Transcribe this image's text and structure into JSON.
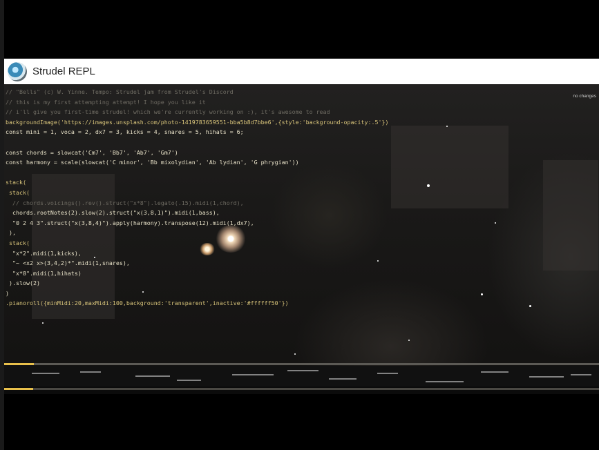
{
  "header": {
    "title": "Strudel REPL",
    "logo_icon": "strudel-logo-icon"
  },
  "editor": {
    "status": "no changes",
    "lines": [
      {
        "text": "// \"Bells\" (c) W. Yinne. Tempo: Strudel jam from Strudel's Discord",
        "cls": "c-comment"
      },
      {
        "text": "// this is my first attempting attempt! I hope you like it",
        "cls": "c-comment"
      },
      {
        "text": "// i'll give you first-time strudel! which we're currently working on :), it's awesome to read",
        "cls": "c-comment"
      },
      {
        "text": "backgroundImage('https://images.unsplash.com/photo-1419783659551-bba5b8d7bbe6',{style:'background-opacity:.5'})",
        "cls": "c-kw"
      },
      {
        "text": "const mini = 1, voca = 2, dx7 = 3, kicks = 4, snares = 5, hihats = 6;",
        "cls": ""
      },
      {
        "text": "",
        "cls": ""
      },
      {
        "text": "const chords = slowcat('Cm7', 'Bb7', 'Ab7', 'Gm7')",
        "cls": ""
      },
      {
        "text": "const harmony = scale(slowcat('C minor', 'Bb mixolydian', 'Ab lydian', 'G phrygian'))",
        "cls": ""
      },
      {
        "text": "",
        "cls": ""
      },
      {
        "text": "stack(",
        "cls": "c-kw"
      },
      {
        "text": " stack(",
        "cls": "c-kw"
      },
      {
        "text": "  // chords.voicings().rev().struct(\"x*8\").legato(.15).midi(1,chord),",
        "cls": "c-comment"
      },
      {
        "text": "  chords.rootNotes(2).slow(2).struct(\"x(3,8,1)\").midi(1,bass),",
        "cls": ""
      },
      {
        "text": "  \"0 2 4 3\".struct(\"x(3,8,4)\").apply(harmony).transpose(12).midi(1,dx7),",
        "cls": ""
      },
      {
        "text": " ),",
        "cls": ""
      },
      {
        "text": " stack(",
        "cls": "c-kw"
      },
      {
        "text": "  \"x*2\".midi(1,kicks),",
        "cls": ""
      },
      {
        "text": "  \"~ <x2 x>(3,4,2)*\".midi(1,snares),",
        "cls": ""
      },
      {
        "text": "  \"x*8\".midi(1,hihats)",
        "cls": ""
      },
      {
        "text": " ).slow(2)",
        "cls": ""
      },
      {
        "text": ")",
        "cls": ""
      },
      {
        "text": ".pianoroll({minMidi:20,maxMidi:100,background:'transparent',inactive:'#ffffff50'})",
        "cls": "c-kw"
      }
    ]
  },
  "timeline": {
    "progress": 0.05
  }
}
